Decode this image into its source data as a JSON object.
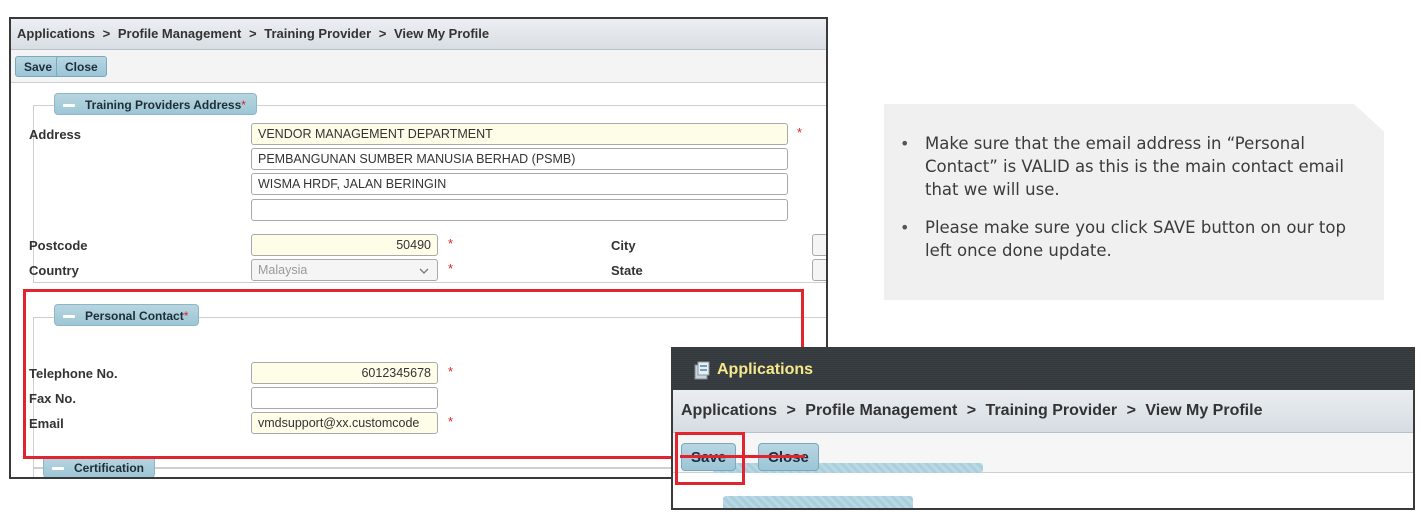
{
  "breadcrumb": [
    "Applications",
    "Profile Management",
    "Training Provider",
    "View My Profile"
  ],
  "breadcrumb_separator": ">",
  "toolbar": {
    "save_label": "Save",
    "close_label": "Close"
  },
  "sections": {
    "address": {
      "title": "Training Providers Address",
      "address_label": "Address",
      "address_lines": [
        "VENDOR MANAGEMENT DEPARTMENT",
        "PEMBANGUNAN SUMBER MANUSIA BERHAD (PSMB)",
        "WISMA HRDF, JALAN BERINGIN",
        ""
      ],
      "postcode_label": "Postcode",
      "postcode_value": "50490",
      "city_label": "City",
      "country_label": "Country",
      "country_value": "Malaysia",
      "state_label": "State"
    },
    "personal_contact": {
      "title": "Personal Contact",
      "telephone_label": "Telephone No.",
      "telephone_value": "6012345678",
      "fax_label": "Fax No.",
      "fax_value": "",
      "email_label": "Email",
      "email_value": "vmdsupport@xx.customcode"
    },
    "certification": {
      "title": "Certification"
    }
  },
  "required_marker": "*",
  "callout": {
    "items": [
      "Make sure that the email address in “Personal Contact” is VALID as this is the main contact email that we will use.",
      "Please make sure you click SAVE button on our top left once done update."
    ]
  },
  "zoom": {
    "app_title": "Applications",
    "breadcrumb": [
      "Applications",
      "Profile Management",
      "Training Provider",
      "View My Profile"
    ],
    "save_label": "Save",
    "close_label": "Close"
  },
  "colors": {
    "highlight_red": "#e1252f",
    "button_blue": "#9cc5d6",
    "required_red": "#dd2222",
    "header_dark": "#363b40",
    "header_title_yellow": "#f6e98a",
    "input_yellow": "#fdfde8"
  },
  "icons": {
    "app_icon": "applications-icon",
    "collapse_icon": "minus-icon"
  }
}
